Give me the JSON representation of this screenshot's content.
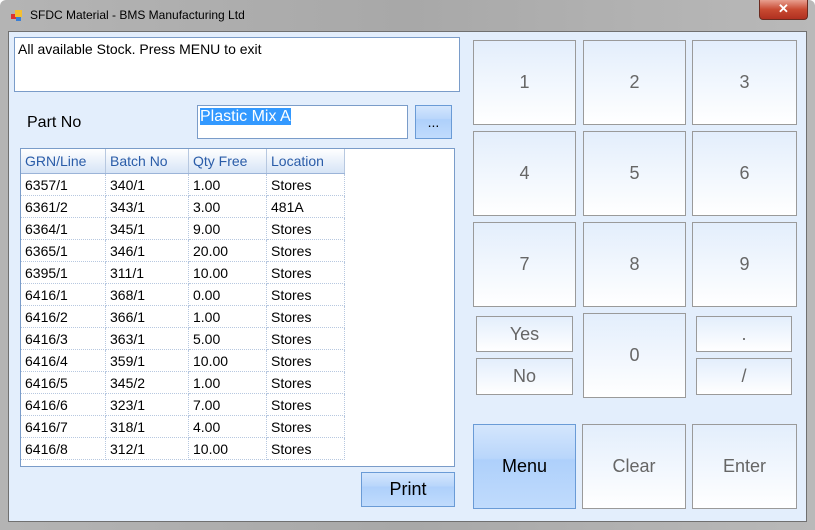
{
  "window": {
    "title": "SFDC Material - BMS Manufacturing Ltd",
    "close": "✕"
  },
  "message": "All available Stock. Press MENU to exit",
  "part": {
    "label": "Part No",
    "value": "Plastic Mix A",
    "browse": "..."
  },
  "grid": {
    "columns": [
      "GRN/Line",
      "Batch No",
      "Qty Free",
      "Location"
    ],
    "rows": [
      [
        "6357/1",
        "340/1",
        "1.00",
        "Stores"
      ],
      [
        "6361/2",
        "343/1",
        "3.00",
        "481A"
      ],
      [
        "6364/1",
        "345/1",
        "9.00",
        "Stores"
      ],
      [
        "6365/1",
        "346/1",
        "20.00",
        "Stores"
      ],
      [
        "6395/1",
        "311/1",
        "10.00",
        "Stores"
      ],
      [
        "6416/1",
        "368/1",
        "0.00",
        "Stores"
      ],
      [
        "6416/2",
        "366/1",
        "1.00",
        "Stores"
      ],
      [
        "6416/3",
        "363/1",
        "5.00",
        "Stores"
      ],
      [
        "6416/4",
        "359/1",
        "10.00",
        "Stores"
      ],
      [
        "6416/5",
        "345/2",
        "1.00",
        "Stores"
      ],
      [
        "6416/6",
        "323/1",
        "7.00",
        "Stores"
      ],
      [
        "6416/7",
        "318/1",
        "4.00",
        "Stores"
      ],
      [
        "6416/8",
        "312/1",
        "10.00",
        "Stores"
      ]
    ]
  },
  "print": "Print",
  "keypad": {
    "k1": "1",
    "k2": "2",
    "k3": "3",
    "k4": "4",
    "k5": "5",
    "k6": "6",
    "k7": "7",
    "k8": "8",
    "k9": "9",
    "k0": "0",
    "yes": "Yes",
    "no": "No",
    "dot": ".",
    "slash": "/",
    "menu": "Menu",
    "clear": "Clear",
    "enter": "Enter"
  }
}
